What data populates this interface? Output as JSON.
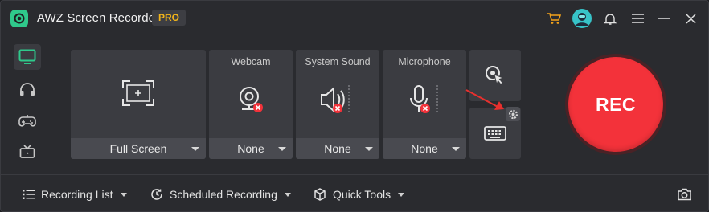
{
  "app": {
    "title": "AWZ Screen Recorder",
    "badge": "PRO"
  },
  "titlebar_icons": [
    "cart-icon",
    "avatar-icon",
    "bell-icon",
    "menu-icon",
    "minimize-icon",
    "close-icon"
  ],
  "sidebar": {
    "items": [
      {
        "name": "screen",
        "icon": "monitor-icon",
        "active": true
      },
      {
        "name": "audio",
        "icon": "headphones-icon",
        "active": false
      },
      {
        "name": "game",
        "icon": "gamepad-icon",
        "active": false
      },
      {
        "name": "tv",
        "icon": "tv-icon",
        "active": false
      }
    ]
  },
  "tiles": {
    "screen": {
      "label": "",
      "value": "Full Screen"
    },
    "webcam": {
      "label": "Webcam",
      "value": "None"
    },
    "system_sound": {
      "label": "System Sound",
      "value": "None"
    },
    "microphone": {
      "label": "Microphone",
      "value": "None"
    }
  },
  "rec": {
    "label": "REC"
  },
  "bottom": {
    "recording_list": "Recording List",
    "scheduled_recording": "Scheduled Recording",
    "quick_tools": "Quick Tools"
  },
  "colors": {
    "accent_green": "#2fc98b",
    "rec_red": "#f3323a",
    "pro_gold": "#f3b51a",
    "cart_orange": "#f3a21a"
  }
}
